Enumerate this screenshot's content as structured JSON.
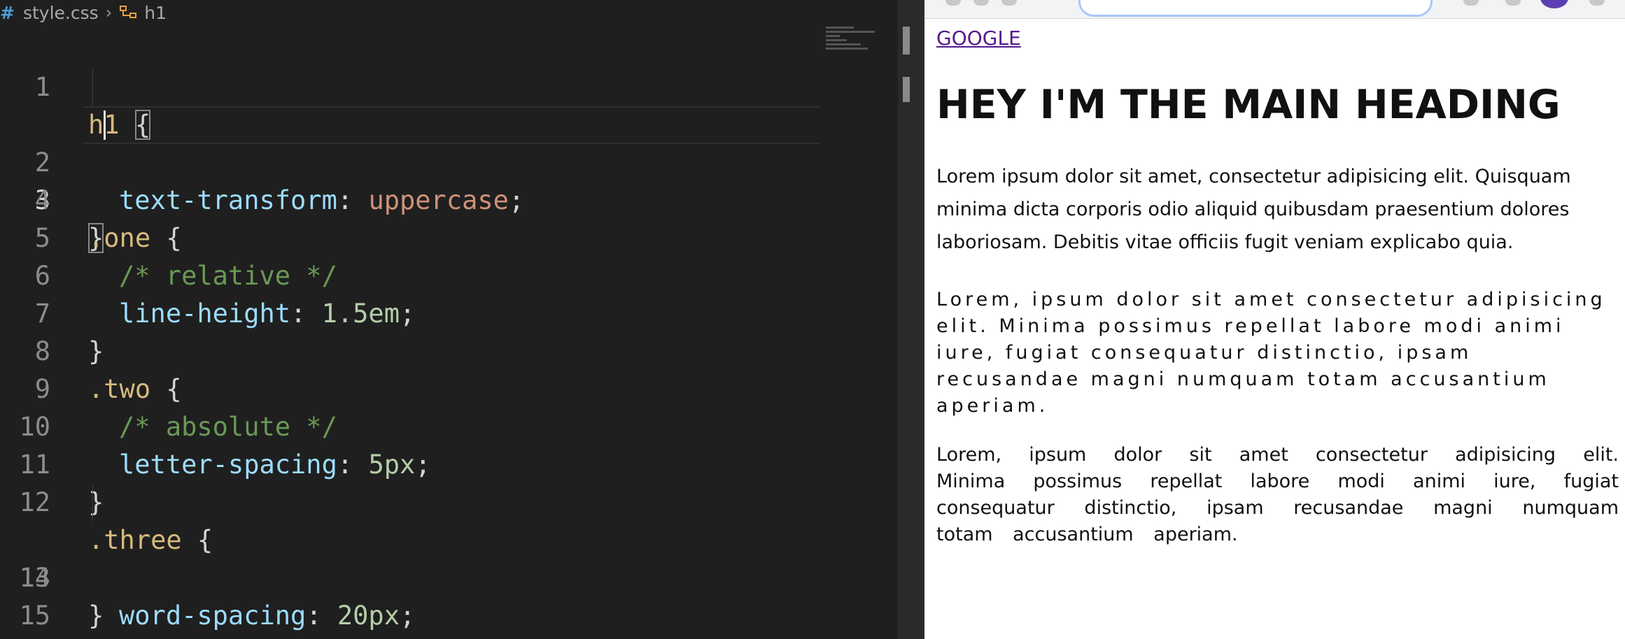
{
  "breadcrumb": {
    "file": "style.css",
    "symbol": "h1"
  },
  "code_lines": [
    {
      "n": "1"
    },
    {
      "n": "2"
    },
    {
      "n": "3"
    },
    {
      "n": "4"
    },
    {
      "n": "5"
    },
    {
      "n": "6"
    },
    {
      "n": "7"
    },
    {
      "n": "8"
    },
    {
      "n": "9"
    },
    {
      "n": "10"
    },
    {
      "n": "11"
    },
    {
      "n": "12"
    },
    {
      "n": "13"
    },
    {
      "n": "14"
    },
    {
      "n": "15"
    }
  ],
  "code": {
    "l1_sel": "h1",
    "l1_brace": "{",
    "l2_prop": "text-transform",
    "l2_val": "uppercase",
    "l3_brace": "}",
    "l4_sel": ".one",
    "l5_cmt": "/* relative */",
    "l6_prop": "line-height",
    "l6_val": "1.5em",
    "l8_sel": ".two",
    "l9_cmt": "/* absolute */",
    "l10_prop": "letter-spacing",
    "l10_val": "5px",
    "l12_sel": ".three",
    "l13_prop": "word-spacing",
    "l13_val": "20px"
  },
  "browser": {
    "link": "GOOGLE",
    "heading": "hey I'm the main heading",
    "p1": "Lorem ipsum dolor sit amet, consectetur adipisicing elit. Quisquam minima dicta corporis odio aliquid quibusdam praesentium dolores laboriosam. Debitis vitae officiis fugit veniam explicabo quia.",
    "p2": "Lorem, ipsum dolor sit amet consectetur adipisicing elit. Minima possimus repellat labore modi animi iure, fugiat consequatur distinctio, ipsam recusandae magni numquam totam accusantium aperiam.",
    "p3": "Lorem, ipsum dolor sit amet consectetur adipisicing elit. Minima possimus repellat labore modi animi iure, fugiat consequatur distinctio, ipsam recusandae magni numquam totam accusantium aperiam."
  },
  "colors": {
    "editor_bg": "#1f1f1f",
    "selector": "#d7ba7d",
    "property": "#9cdcfe",
    "string_value": "#ce9178",
    "number_value": "#b5cea8",
    "comment": "#6a9955",
    "link": "#551a8b"
  }
}
